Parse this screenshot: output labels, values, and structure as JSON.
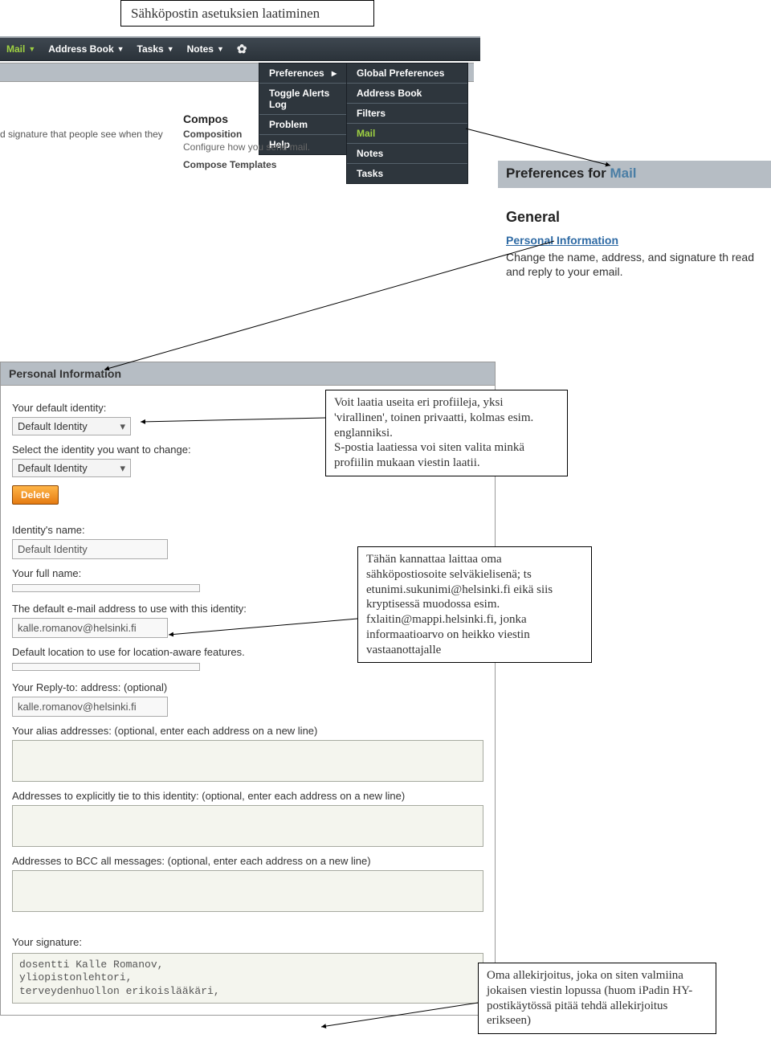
{
  "doc": {
    "title": "Sähköpostin asetuksien laatiminen",
    "callout_profile": "Voit laatia useita eri profiileja, yksi 'virallinen', toinen privaatti, kolmas esim. englanniksi.\nS-postia laatiessa voi siten valita minkä profiilin mukaan viestin laatii.",
    "callout_email": "Tähän kannattaa laittaa oma sähköpostiosoite selväkielisenä; ts etunimi.sukunimi@helsinki.fi eikä siis kryptisessä muodossa  esim. fxlaitin@mappi.helsinki.fi, jonka informaatioarvo on heikko  viestin vastaanottajalle",
    "callout_sig": "Oma allekirjoitus, joka on siten valmiina jokaisen viestin lopussa (huom iPadin HY-postikäytössä pitää tehdä allekirjoitus erikseen)"
  },
  "menubar": {
    "mail": "Mail",
    "address": "Address Book",
    "tasks": "Tasks",
    "notes": "Notes"
  },
  "dd_left": {
    "preferences": "Preferences",
    "toggle": "Toggle Alerts Log",
    "problem": "Problem",
    "help": "Help"
  },
  "dd_right": {
    "global": "Global Preferences",
    "address": "Address Book",
    "filters": "Filters",
    "mail": "Mail",
    "notes": "Notes",
    "tasks": "Tasks"
  },
  "compos": {
    "head": "Compos",
    "sub": "Composition",
    "desc": "Configure how you send mail.",
    "tmpl": "Compose Templates"
  },
  "sig_frag": "d signature that people see when they",
  "pref_header": {
    "prefix": "Preferences for ",
    "mail": "Mail"
  },
  "general": {
    "head": "General",
    "link": "Personal Information",
    "desc": "Change the name, address, and signature th read and reply to your email."
  },
  "form": {
    "section": "Personal Information",
    "default_identity_lbl": "Your default identity:",
    "default_identity_val": "Default Identity",
    "select_identity_lbl": "Select the identity you want to change:",
    "select_identity_val": "Default Identity",
    "delete": "Delete",
    "identity_name_lbl": "Identity's name:",
    "identity_name_val": "Default Identity",
    "full_name_lbl": "Your full name:",
    "full_name_val": "",
    "default_email_lbl": "The default e-mail address to use with this identity:",
    "default_email_val": "kalle.romanov@helsinki.fi",
    "location_lbl": "Default location to use for location-aware features.",
    "replyto_lbl": "Your Reply-to: address: (optional)",
    "replyto_val": "kalle.romanov@helsinki.fi",
    "alias_lbl": "Your alias addresses: (optional, enter each address on a new line)",
    "tie_lbl": "Addresses to explicitly tie to this identity: (optional, enter each address on a new line)",
    "bcc_lbl": "Addresses to BCC all messages: (optional, enter each address on a new line)",
    "sig_lbl": "Your signature:",
    "sig_val": "dosentti Kalle Romanov,\nyliopistonlehtori,\nterveydenhuollon erikoislääkäri,"
  }
}
